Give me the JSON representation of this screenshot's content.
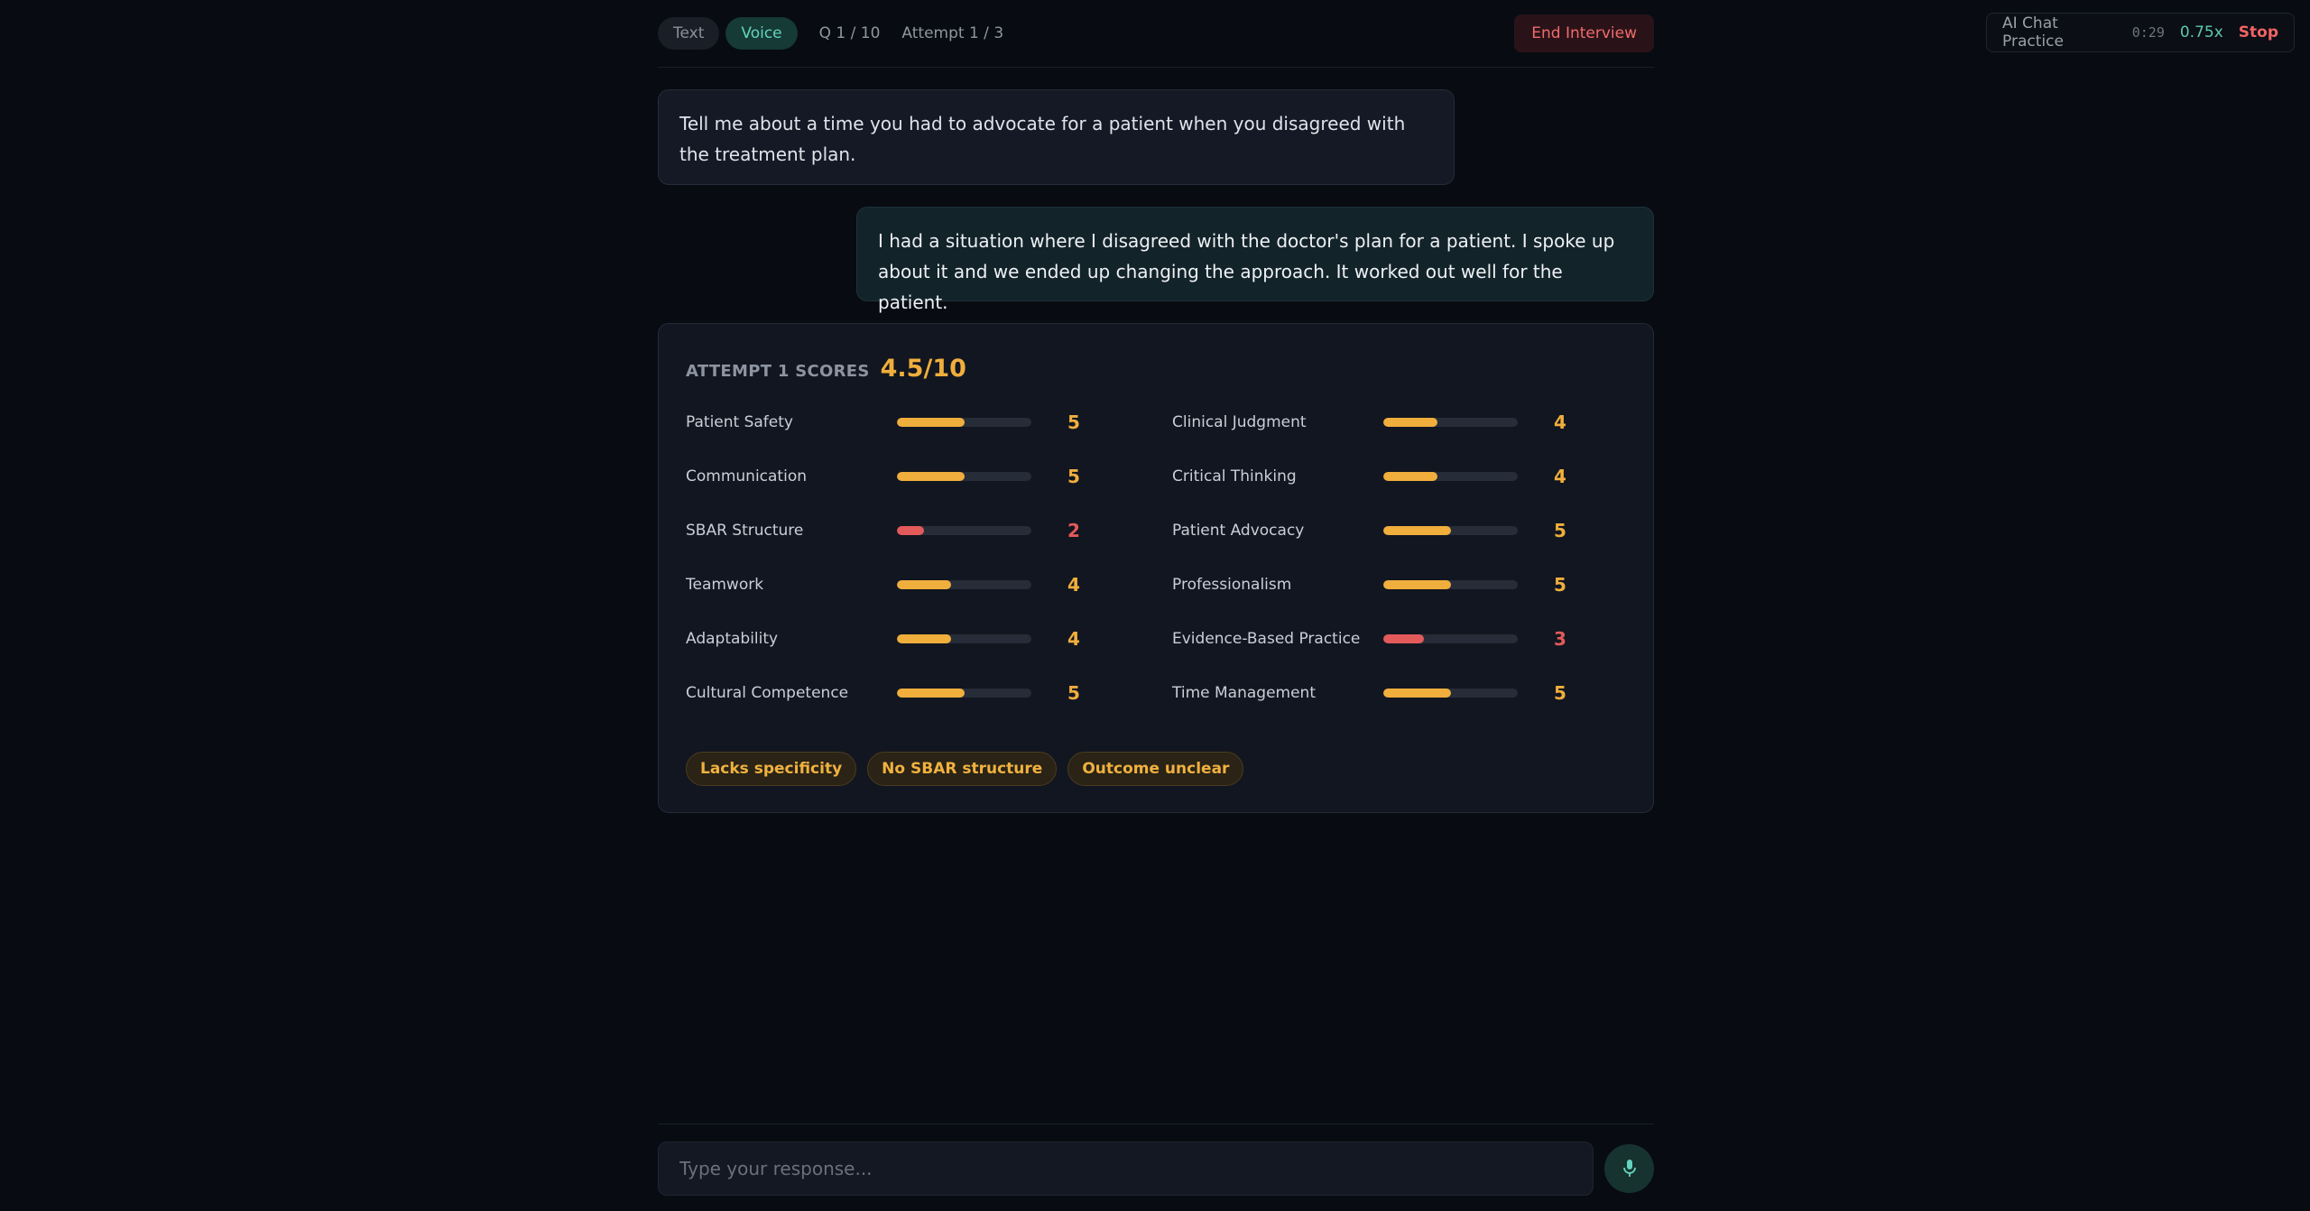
{
  "topbar": {
    "modes": [
      {
        "label": "Text",
        "active": false
      },
      {
        "label": "Voice",
        "active": true
      }
    ],
    "question_counter": "Q 1 / 10",
    "attempt_counter": "Attempt 1 / 3",
    "end_button": "End Interview"
  },
  "practice_widget": {
    "title": "AI Chat Practice",
    "time": "0:29",
    "speed": "0.75x",
    "stop": "Stop"
  },
  "conversation": {
    "question": "Tell me about a time you had to advocate for a patient when you disagreed with the treatment plan.",
    "answer": "I had a situation where I disagreed with the doctor's plan for a patient. I spoke up about it and we ended up changing the approach. It worked out well for the patient."
  },
  "scores": {
    "label": "ATTEMPT 1 SCORES",
    "total": "4.5/10",
    "max": 10,
    "items": [
      {
        "name": "Patient Safety",
        "value": 5
      },
      {
        "name": "Clinical Judgment",
        "value": 4
      },
      {
        "name": "Communication",
        "value": 5
      },
      {
        "name": "Critical Thinking",
        "value": 4
      },
      {
        "name": "SBAR Structure",
        "value": 2
      },
      {
        "name": "Patient Advocacy",
        "value": 5
      },
      {
        "name": "Teamwork",
        "value": 4
      },
      {
        "name": "Professionalism",
        "value": 5
      },
      {
        "name": "Adaptability",
        "value": 4
      },
      {
        "name": "Evidence-Based Practice",
        "value": 3
      },
      {
        "name": "Cultural Competence",
        "value": 5
      },
      {
        "name": "Time Management",
        "value": 5
      }
    ],
    "tags": [
      "Lacks specificity",
      "No SBAR structure",
      "Outcome unclear"
    ]
  },
  "colors": {
    "score_good": "#f0ae3c",
    "score_low": "#e35a5a",
    "accent_teal": "#63d3bd"
  },
  "input": {
    "placeholder": "Type your response...",
    "mic_icon": "microphone-icon"
  }
}
